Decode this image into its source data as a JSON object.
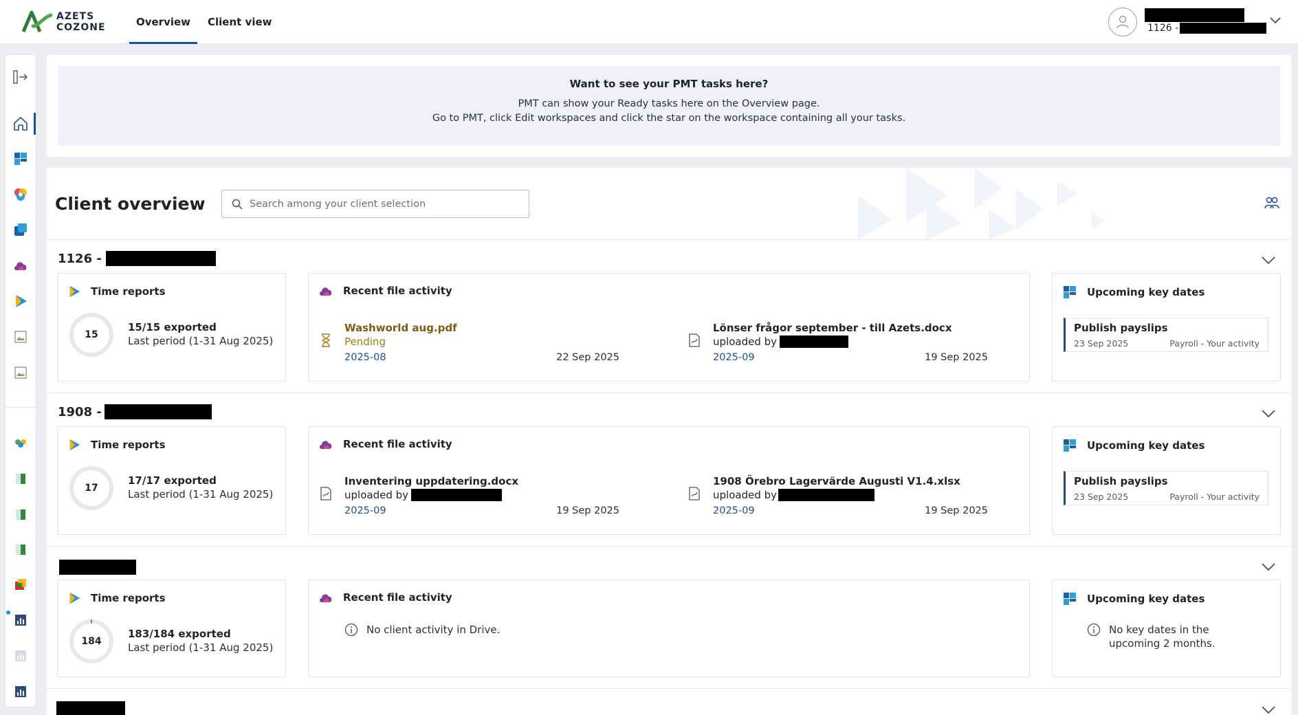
{
  "brand": {
    "line1": "AZETS",
    "line2": "COZONE"
  },
  "tabs": [
    {
      "label": "Overview",
      "active": true
    },
    {
      "label": "Client view",
      "active": false
    }
  ],
  "user": {
    "sub_prefix": "1126 -"
  },
  "banner": {
    "title": "Want to see your PMT tasks here?",
    "line1": "PMT can show your Ready tasks here on the Overview page.",
    "line2": "Go to PMT, click Edit workspaces and click the star on the workspace containing all your tasks."
  },
  "overview": {
    "title": "Client overview",
    "search_placeholder": "Search among your client selection"
  },
  "card_titles": {
    "time_reports": "Time reports",
    "file_activity": "Recent file activity",
    "key_dates": "Upcoming key dates"
  },
  "clients": [
    {
      "code": "1126 -",
      "time": {
        "ring_total": 15,
        "exported_done": 15,
        "exported_total": 15,
        "exported": "15/15 exported",
        "period": "Last period (1-31 Aug 2025)"
      },
      "files": [
        {
          "name": "Washworld aug.pdf",
          "status": "Pending",
          "period": "2025-08",
          "date": "22 Sep 2025",
          "pending": true
        },
        {
          "name": "Lönser frågor september - till Azets.docx",
          "status": "uploaded by",
          "period": "2025-09",
          "date": "19 Sep 2025",
          "pending": false
        }
      ],
      "keydate": {
        "title": "Publish payslips",
        "date": "23 Sep 2025",
        "category": "Payroll - Your activity"
      }
    },
    {
      "code": "1908 -",
      "time": {
        "ring_total": 17,
        "exported_done": 17,
        "exported_total": 17,
        "exported": "17/17 exported",
        "period": "Last period (1-31 Aug 2025)"
      },
      "files": [
        {
          "name": "Inventering uppdatering.docx",
          "status": "uploaded by",
          "period": "2025-09",
          "date": "19 Sep 2025",
          "pending": false
        },
        {
          "name": "1908 Örebro Lagervärde Augusti V1.4.xlsx",
          "status": "uploaded by",
          "period": "2025-09",
          "date": "19 Sep 2025",
          "pending": false
        }
      ],
      "keydate": {
        "title": "Publish payslips",
        "date": "23 Sep 2025",
        "category": "Payroll - Your activity"
      }
    },
    {
      "code": "",
      "time": {
        "ring_total": 184,
        "exported_done": 183,
        "exported_total": 184,
        "exported": "183/184 exported",
        "period": "Last period (1-31 Aug 2025)"
      },
      "no_files": "No client activity in Drive.",
      "no_keydates_l1": "No key dates in the",
      "no_keydates_l2": "upcoming 2 months."
    }
  ],
  "colors": {
    "accent": "#1d4ea0",
    "pending": "#a47b16",
    "banner_bg": "#eff0fb"
  },
  "icons": [
    "collapse-panel-icon",
    "home-icon",
    "payroll-app-icon",
    "colour-app-icon",
    "tiles-app-icon",
    "drive-cloud-icon",
    "time-play-icon",
    "image-icon",
    "group-icon",
    "spreadsheet-icon",
    "chart-icon",
    "people-icon",
    "chevron-down-icon",
    "hourglass-icon",
    "file-icon",
    "info-icon",
    "search-icon",
    "user-icon"
  ]
}
